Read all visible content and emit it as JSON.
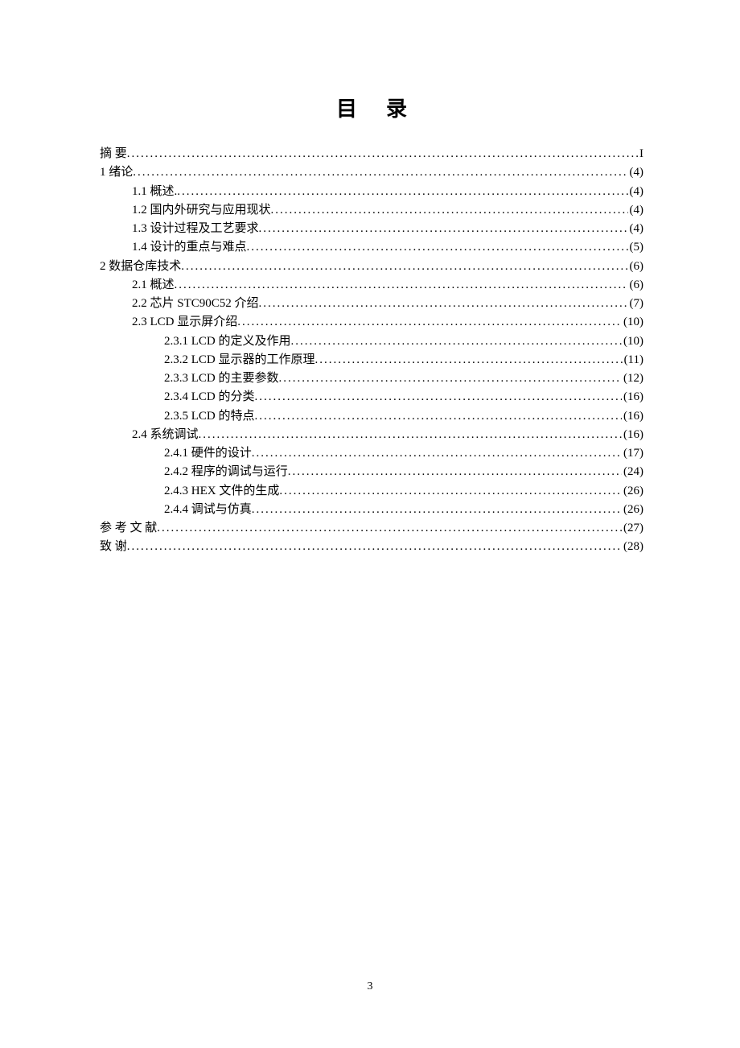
{
  "title": "目录",
  "page_number": "3",
  "entries": [
    {
      "level": 0,
      "label": "摘   要",
      "page": "I"
    },
    {
      "level": 0,
      "label": "1 绪论",
      "page": "(4)"
    },
    {
      "level": 1,
      "label": "1.1 概述.",
      "page": "(4)"
    },
    {
      "level": 1,
      "label": "1.2 国内外研究与应用现状",
      "page": "(4)"
    },
    {
      "level": 1,
      "label": "1.3 设计过程及工艺要求",
      "page": "(4)"
    },
    {
      "level": 1,
      "label": "1.4 设计的重点与难点",
      "page": "(5)"
    },
    {
      "level": 0,
      "label": "2 数据仓库技术",
      "page": "(6)"
    },
    {
      "level": 1,
      "label": "2.1 概述 ",
      "page": "(6)"
    },
    {
      "level": 1,
      "label": "2.2 芯片 STC90C52 介绍",
      "page": "(7)"
    },
    {
      "level": 1,
      "label": "2.3 LCD 显示屏介绍",
      "page": "(10)"
    },
    {
      "level": 2,
      "label": "2.3.1 LCD 的定义及作用 ",
      "page": "(10)"
    },
    {
      "level": 2,
      "label": "2.3.2  LCD 显示器的工作原理 ",
      "page": "(11)"
    },
    {
      "level": 2,
      "label": "2.3.3 LCD 的主要参数 ",
      "page": "(12)"
    },
    {
      "level": 2,
      "label": "2.3.4 LCD 的分类 ",
      "page": "(16)"
    },
    {
      "level": 2,
      "label": "2.3.5 LCD 的特点 ",
      "page": "(16)"
    },
    {
      "level": 1,
      "label": "2.4 系统调试 ",
      "page": "(16)"
    },
    {
      "level": 2,
      "label": "2.4.1 硬件的设计",
      "page": "(17)"
    },
    {
      "level": 2,
      "label": "2.4.2 程序的调试与运行",
      "page": "(24)"
    },
    {
      "level": 2,
      "label": "2.4.3 HEX 文件的生成 ",
      "page": "(26)"
    },
    {
      "level": 2,
      "label": "2.4.4 调试与仿真 ",
      "page": "(26)"
    },
    {
      "level": 0,
      "label": "参 考 文 献",
      "page": "(27)"
    },
    {
      "level": 0,
      "label": "致   谢",
      "page": "(28)"
    }
  ]
}
